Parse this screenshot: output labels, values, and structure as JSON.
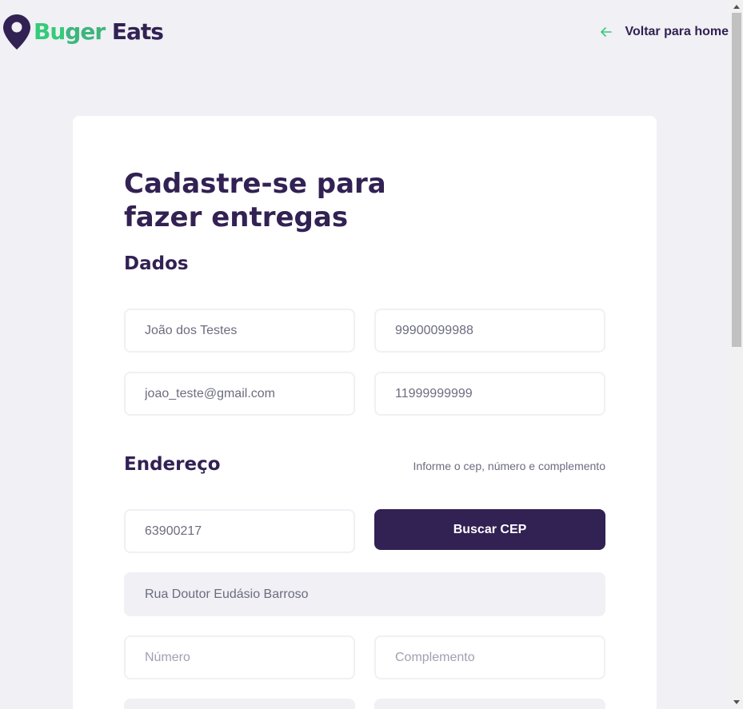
{
  "brand": {
    "part1": "Bu",
    "part2": "ger",
    "part3": " Eats"
  },
  "nav": {
    "back_label": "Voltar para home"
  },
  "form": {
    "title_line1": "Cadastre-se para",
    "title_line2": "fazer entregas",
    "section_dados": "Dados",
    "section_endereco": "Endereço",
    "endereco_hint": "Informe o cep, número e complemento",
    "fields": {
      "name": "João dos Testes",
      "cpf": "99900099988",
      "email": "joao_teste@gmail.com",
      "whatsapp": "11999999999",
      "cep": "63900217",
      "address": "Rua Doutor Eudásio Barroso",
      "number_placeholder": "Número",
      "complement_placeholder": "Complemento"
    },
    "buscar_cep_label": "Buscar CEP"
  },
  "colors": {
    "primary": "#322153",
    "accent": "#34cb79",
    "background": "#f0f0f5"
  },
  "icons": {
    "logo": "map-pin-icon",
    "back": "arrow-left-icon"
  }
}
